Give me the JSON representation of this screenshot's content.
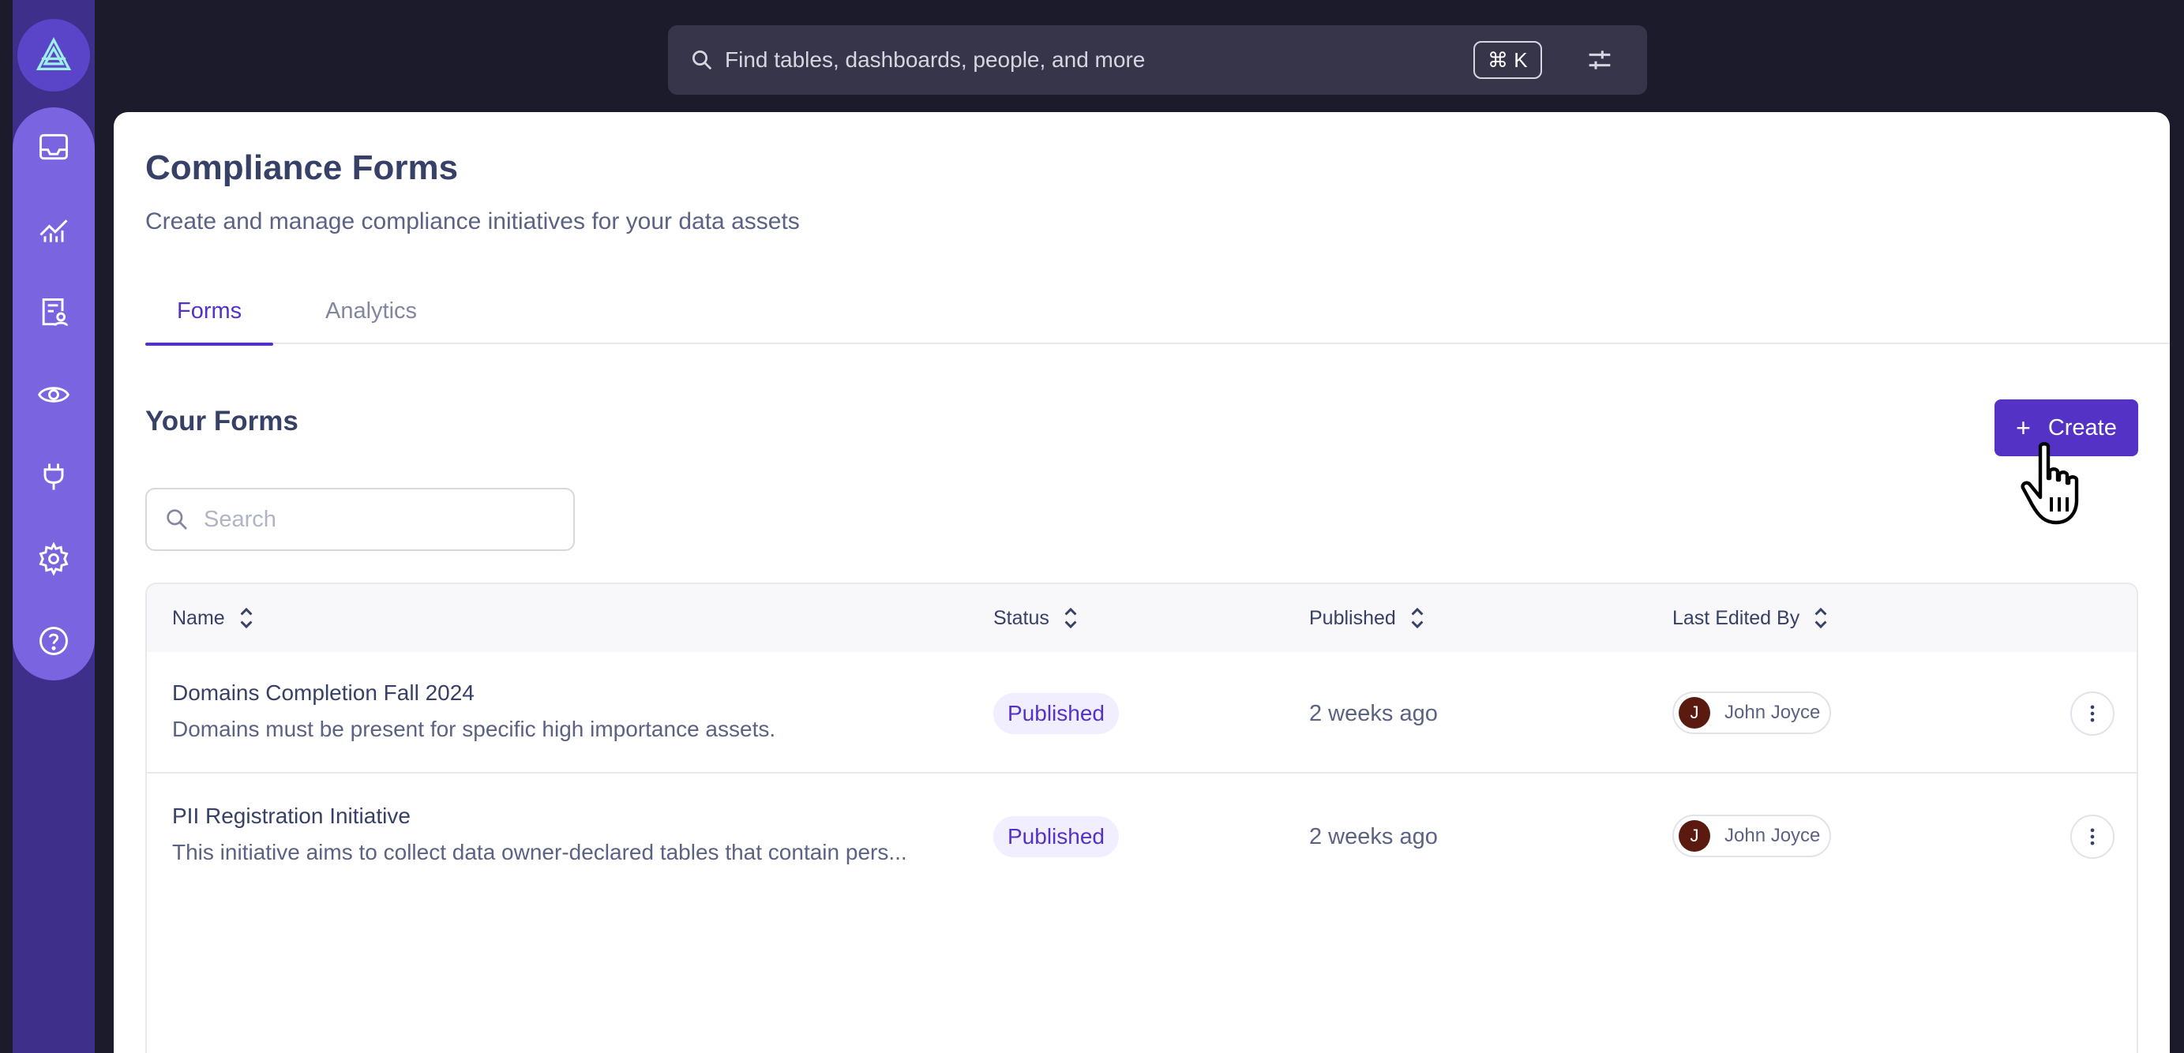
{
  "header": {
    "search_placeholder": "Find tables, dashboards, people, and more",
    "shortcut": "⌘ K",
    "search_icon": "search-icon",
    "filter_icon": "sliders-icon"
  },
  "sidebar": {
    "logo_icon": "logo-icon",
    "items": [
      {
        "icon": "inbox-icon"
      },
      {
        "icon": "analytics-chart-icon"
      },
      {
        "icon": "forms-icon"
      },
      {
        "icon": "eye-icon"
      },
      {
        "icon": "plug-icon"
      },
      {
        "icon": "gear-icon"
      },
      {
        "icon": "help-icon"
      }
    ]
  },
  "page": {
    "title": "Compliance Forms",
    "subtitle": "Create and manage compliance initiatives for your data assets",
    "tabs": [
      {
        "label": "Forms",
        "active": true
      },
      {
        "label": "Analytics",
        "active": false
      }
    ],
    "section_title": "Your Forms",
    "create_label": "Create",
    "search_placeholder": "Search"
  },
  "table": {
    "columns": [
      "Name",
      "Status",
      "Published",
      "Last Edited By"
    ],
    "rows": [
      {
        "name": "Domains Completion Fall 2024",
        "description": "Domains must be present for specific high importance assets.",
        "status": "Published",
        "published": "2 weeks ago",
        "editor_initial": "J",
        "editor": "John Joyce"
      },
      {
        "name": "PII Registration Initiative",
        "description": "This initiative aims to collect data owner-declared tables that contain pers...",
        "status": "Published",
        "published": "2 weeks ago",
        "editor_initial": "J",
        "editor": "John Joyce"
      }
    ]
  },
  "colors": {
    "accent": "#5532c6",
    "sidebar": "#7a64e0",
    "header_bg": "#1c1b2b",
    "badge_bg": "#f1efff",
    "avatar_bg": "#5a1a10"
  }
}
